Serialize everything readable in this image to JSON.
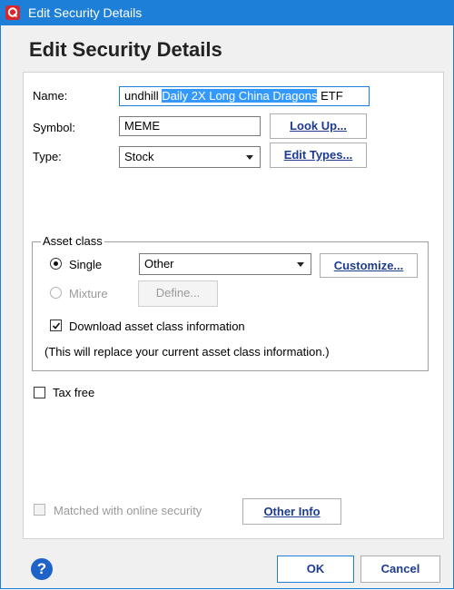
{
  "window": {
    "title": "Edit Security Details"
  },
  "heading": "Edit Security Details",
  "fields": {
    "name_label": "Name:",
    "name_value_prefix": "undhill ",
    "name_value_selected": "Daily 2X Long China Dragons",
    "name_value_suffix": " ETF",
    "symbol_label": "Symbol:",
    "symbol_value": "MEME",
    "type_label": "Type:",
    "type_value": "Stock"
  },
  "buttons": {
    "lookup": "Look Up...",
    "edit_types": "Edit Types...",
    "customize": "Customize...",
    "define": "Define...",
    "other_info": "Other Info",
    "ok": "OK",
    "cancel": "Cancel"
  },
  "asset_class": {
    "legend": "Asset class",
    "single_label": "Single",
    "single_selected": true,
    "single_value": "Other",
    "mixture_label": "Mixture",
    "download_label": "Download asset class information",
    "download_checked": true,
    "note": "(This will replace your current asset class information.)"
  },
  "tax_free": {
    "label": "Tax free",
    "checked": false
  },
  "matched": {
    "label": "Matched with online security",
    "checked": false,
    "enabled": false
  },
  "help": "?",
  "colors": {
    "titlebar": "#1d7fd8",
    "selection": "#3399ff",
    "brand": "#d9262b",
    "link_text": "#1d3b8f"
  }
}
